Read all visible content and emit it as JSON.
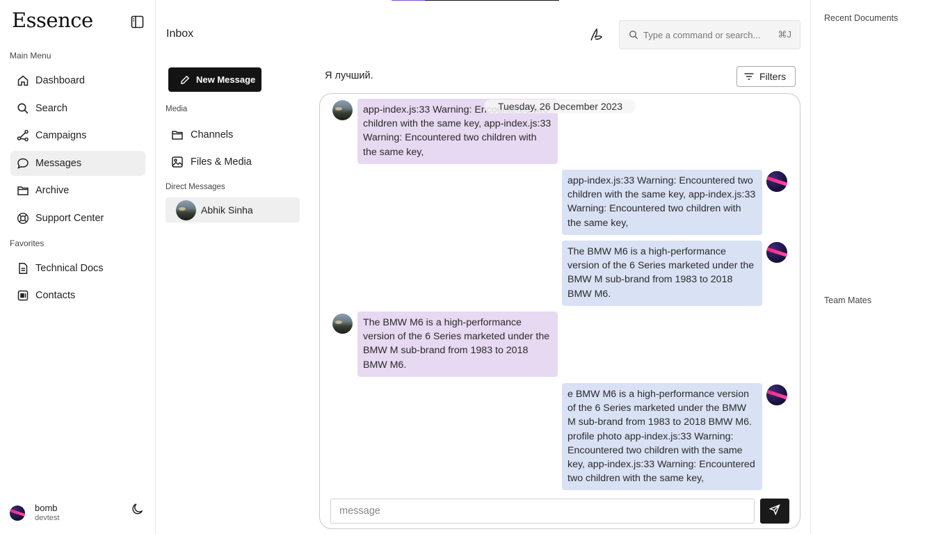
{
  "app": {
    "logo": "Essence"
  },
  "sidebar": {
    "main_menu_label": "Main Menu",
    "main_items": [
      {
        "label": "Dashboard",
        "icon": "home-icon"
      },
      {
        "label": "Search",
        "icon": "search-icon"
      },
      {
        "label": "Campaigns",
        "icon": "share-nodes-icon"
      },
      {
        "label": "Messages",
        "icon": "chat-bubble-icon",
        "active": true
      },
      {
        "label": "Archive",
        "icon": "folder-icon"
      },
      {
        "label": "Support Center",
        "icon": "lifebuoy-icon"
      }
    ],
    "favorites_label": "Favorites",
    "favorite_items": [
      {
        "label": "Technical Docs",
        "icon": "document-icon"
      },
      {
        "label": "Contacts",
        "icon": "contact-card-icon"
      }
    ],
    "user": {
      "name": "bomb",
      "sub": "devtest"
    }
  },
  "inbox": {
    "title": "Inbox",
    "new_message_label": "New Message",
    "media_label": "Media",
    "media_items": [
      {
        "label": "Channels",
        "icon": "folder-icon"
      },
      {
        "label": "Files & Media",
        "icon": "image-icon"
      }
    ],
    "direct_messages_label": "Direct Messages",
    "direct_messages": [
      {
        "name": "Abhik Sinha"
      }
    ]
  },
  "header": {
    "search_placeholder": "Type a command or search...",
    "shortcut": "⌘J"
  },
  "chat": {
    "title": "Я лучший.",
    "filters_label": "Filters",
    "date_divider": "Tuesday, 26 December 2023",
    "messages": [
      {
        "direction": "in",
        "text": "app-index.js:33 Warning: Encountered two children with the same key, app-index.js:33 Warning: Encountered two children with the same key,"
      },
      {
        "direction": "out",
        "text": "app-index.js:33 Warning: Encountered two children with the same key, app-index.js:33 Warning: Encountered two children with the same key,"
      },
      {
        "direction": "out",
        "text": "The BMW M6 is a high-performance version of the 6 Series marketed under the BMW M sub-brand from 1983 to 2018 BMW M6."
      },
      {
        "direction": "in",
        "text": "The BMW M6 is a high-performance version of the 6 Series marketed under the BMW M sub-brand from 1983 to 2018 BMW M6."
      },
      {
        "direction": "out",
        "text": "e BMW M6 is a high-performance version of the 6 Series marketed under the BMW M sub-brand from 1983 to 2018 BMW M6. profile photo app-index.js:33 Warning: Encountered two children with the same key, app-index.js:33 Warning: Encountered two children with the same key,"
      }
    ],
    "composer_placeholder": "message"
  },
  "right_panel": {
    "recent_documents_label": "Recent Documents",
    "team_mates_label": "Team Mates"
  },
  "colors": {
    "incoming_bubble": "#e7d9f2",
    "outgoing_bubble": "#d9e2f4",
    "primary_button": "#141414",
    "active_nav": "#efefef"
  }
}
